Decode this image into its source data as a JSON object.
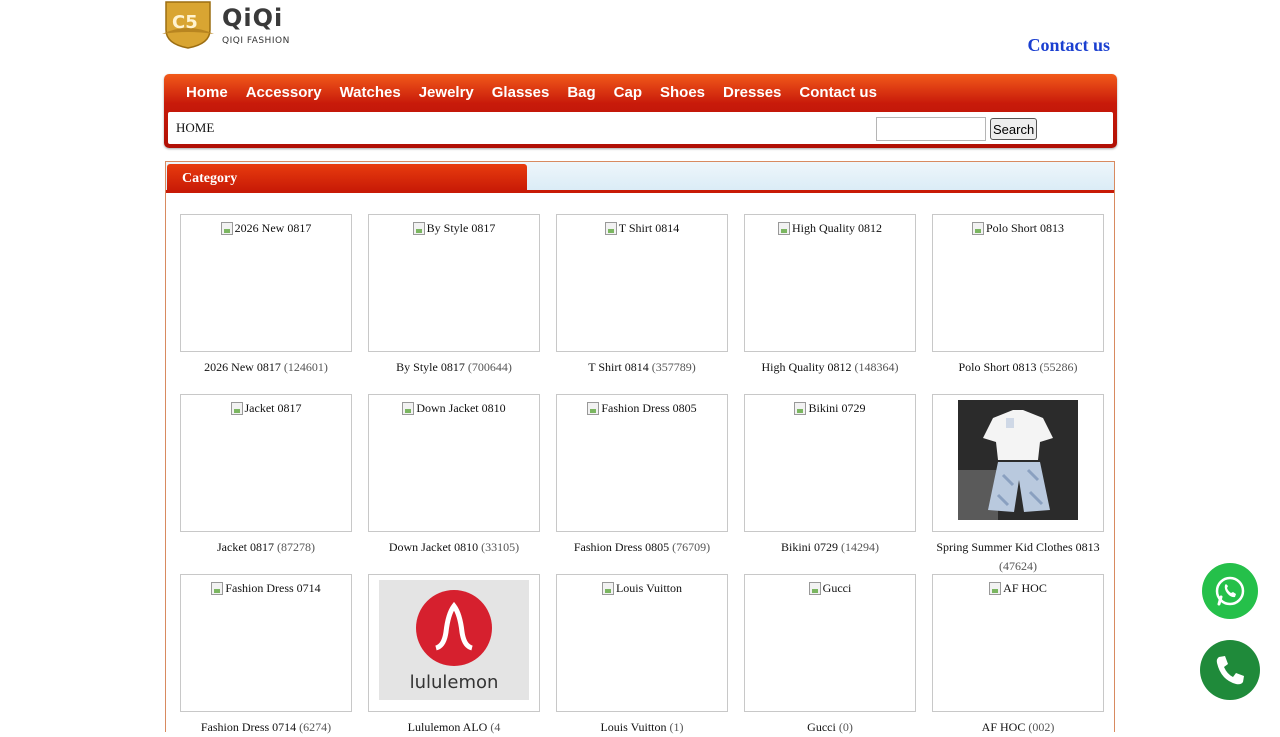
{
  "header": {
    "logo_title": "QiQi",
    "logo_sub": "QIQI FASHION",
    "contact_link": "Contact us"
  },
  "nav": {
    "items": [
      "Home",
      "Accessory",
      "Watches",
      "Jewelry",
      "Glasses",
      "Bag",
      "Cap",
      "Shoes",
      "Dresses",
      "Contact us"
    ],
    "breadcrumb": "HOME",
    "search_placeholder": "",
    "search_button": "Search"
  },
  "panel": {
    "title": "Category"
  },
  "categories": [
    {
      "alt": "2026 New 0817",
      "name": "2026 New 0817",
      "count": "(124601)",
      "image": "broken"
    },
    {
      "alt": "By Style 0817",
      "name": "By Style 0817",
      "count": "(700644)",
      "image": "broken"
    },
    {
      "alt": "T Shirt 0814",
      "name": "T Shirt 0814",
      "count": "(357789)",
      "image": "broken"
    },
    {
      "alt": "High Quality 0812",
      "name": "High Quality 0812",
      "count": "(148364)",
      "image": "broken"
    },
    {
      "alt": "Polo Short 0813",
      "name": "Polo Short 0813",
      "count": "(55286)",
      "image": "broken"
    },
    {
      "alt": "Jacket 0817",
      "name": "Jacket 0817",
      "count": "(87278)",
      "image": "broken"
    },
    {
      "alt": "Down Jacket 0810",
      "name": "Down Jacket 0810",
      "count": "(33105)",
      "image": "broken"
    },
    {
      "alt": "Fashion Dress 0805",
      "name": "Fashion Dress 0805",
      "count": "(76709)",
      "image": "broken"
    },
    {
      "alt": "Bikini 0729",
      "name": "Bikini 0729",
      "count": "(14294)",
      "image": "broken"
    },
    {
      "alt": "",
      "name": "Spring Summer Kid Clothes 0813",
      "count": "(47624)",
      "image": "kid-clothes-photo"
    },
    {
      "alt": "Fashion Dress 0714",
      "name": "Fashion Dress 0714",
      "count": "(6274)",
      "image": "broken"
    },
    {
      "alt": "",
      "name": "Lululemon ALO",
      "count": "(4",
      "image": "lululemon-logo",
      "logo_text": "lululemon"
    },
    {
      "alt": "Louis Vuitton",
      "name": "Louis Vuitton",
      "count": "(1)",
      "image": "broken"
    },
    {
      "alt": "Gucci",
      "name": "Gucci",
      "count": "(0)",
      "image": "broken"
    },
    {
      "alt": "AF HOC",
      "name": "AF HOC",
      "count": "(002)",
      "image": "broken"
    }
  ],
  "floating": {
    "whatsapp_icon": "whatsapp-icon",
    "phone_icon": "phone-icon"
  },
  "colors": {
    "nav_red": "#c81a0a",
    "contact_blue": "#1a3fd0",
    "whatsapp_green": "#25c04a",
    "phone_green": "#1f8a3a"
  }
}
